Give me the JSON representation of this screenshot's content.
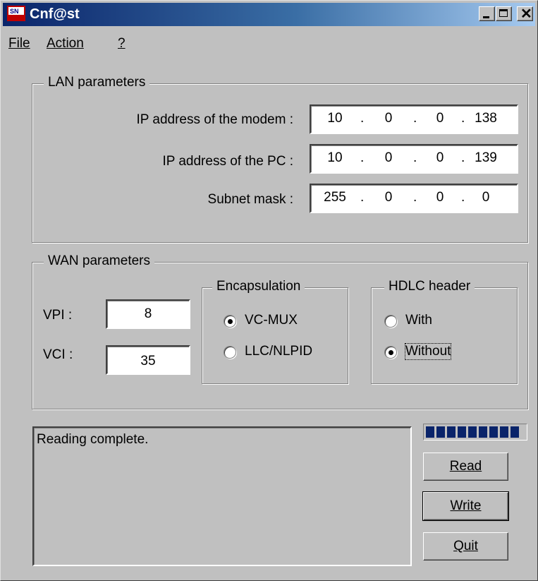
{
  "window": {
    "title": "Cnf@st",
    "app_icon": "cnfast-app-icon"
  },
  "title_buttons": {
    "minimize": "minimize-icon",
    "maximize": "maximize-icon",
    "close": "close-icon"
  },
  "menu": {
    "file": "File",
    "action": "Action",
    "help": "?"
  },
  "lan": {
    "title": "LAN parameters",
    "modem_ip_label": "IP address of the modem :",
    "modem_ip": [
      "10",
      "0",
      "0",
      "138"
    ],
    "pc_ip_label": "IP address of the PC :",
    "pc_ip": [
      "10",
      "0",
      "0",
      "139"
    ],
    "mask_label": "Subnet mask :",
    "mask": [
      "255",
      "0",
      "0",
      "0"
    ]
  },
  "wan": {
    "title": "WAN parameters",
    "vpi_label": "VPI :",
    "vpi": "8",
    "vci_label": "VCI :",
    "vci": "35",
    "encapsulation": {
      "title": "Encapsulation",
      "options": [
        "VC-MUX",
        "LLC/NLPID"
      ],
      "selected": "VC-MUX"
    },
    "hdlc": {
      "title": "HDLC header",
      "options": [
        "With",
        "Without"
      ],
      "selected": "Without"
    }
  },
  "status_text": "Reading complete.",
  "progress": {
    "value": 1.0,
    "color": "#0a246a"
  },
  "buttons": {
    "read": "Read",
    "write": "Write",
    "quit": "Quit"
  }
}
